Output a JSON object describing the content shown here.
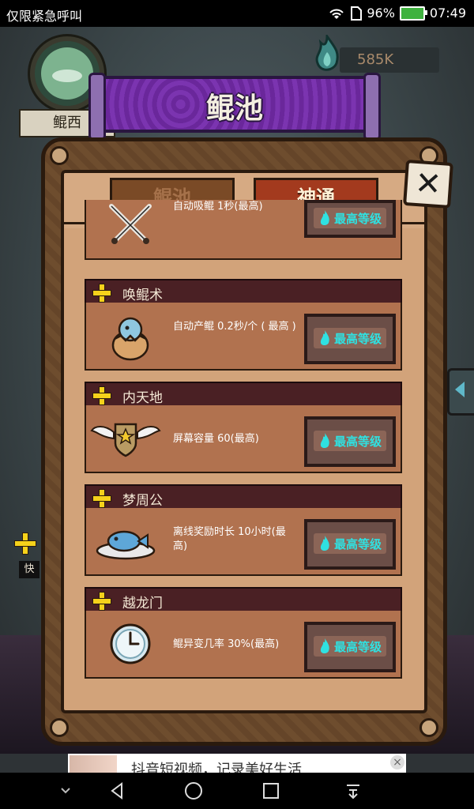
{
  "status_bar": {
    "carrier_text": "仅限紧急呼叫",
    "battery_percent": "96%",
    "time": "07:49"
  },
  "player": {
    "name": "鲲西"
  },
  "currency": {
    "amount": "585K",
    "icon": "spirit-flame-icon"
  },
  "title": "鲲池",
  "tabs": [
    {
      "label": "鲲池",
      "active": false
    },
    {
      "label": "神通",
      "active": true
    }
  ],
  "skills": [
    {
      "name": "",
      "description": "自动吸鲲 1秒(最高)",
      "button": "最高等级",
      "icon": "crossed-swords-icon"
    },
    {
      "name": "唤鲲术",
      "description": "自动产鲲 0.2秒/个 ( 最高 )",
      "button": "最高等级",
      "icon": "egg-chick-icon"
    },
    {
      "name": "内天地",
      "description": "屏幕容量 60(最高)",
      "button": "最高等级",
      "icon": "winged-star-badge-icon"
    },
    {
      "name": "梦周公",
      "description": "离线奖励时长 10小时(最高)",
      "button": "最高等级",
      "icon": "fish-on-plate-icon"
    },
    {
      "name": "越龙门",
      "description": "鲲异变几率 30%(最高)",
      "button": "最高等级",
      "icon": "clock-icon"
    }
  ],
  "side": {
    "tag": "快"
  },
  "ad": {
    "text": "抖音短视频，记录美好生活"
  },
  "colors": {
    "title_banner": "#6e2aa0",
    "active_tab": "#a33a1e",
    "max_text": "#2fe1e1",
    "plus": "#f6d21b"
  }
}
